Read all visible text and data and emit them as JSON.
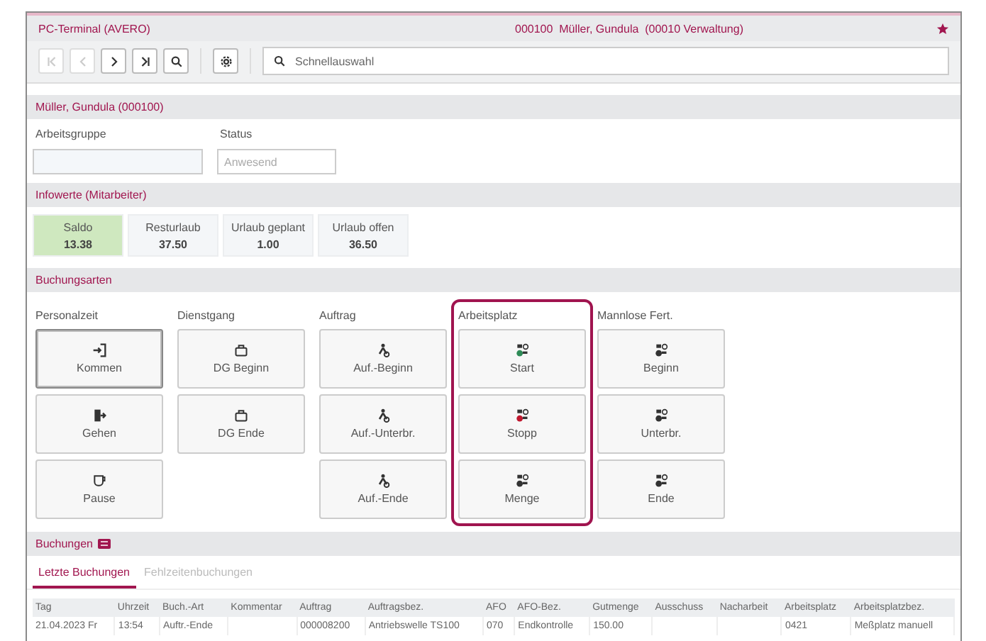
{
  "window": {
    "title": "PC-Terminal (AVERO)",
    "employee": "000100  Müller, Gundula  (00010 Verwaltung)"
  },
  "toolbar": {
    "nav_buttons": [
      {
        "kind": "first",
        "disabled": true
      },
      {
        "kind": "prev",
        "disabled": true
      },
      {
        "kind": "next",
        "disabled": false
      },
      {
        "kind": "last",
        "disabled": false
      }
    ],
    "search": {
      "placeholder": "Schnellauswahl"
    }
  },
  "employee_section": {
    "title": "Müller, Gundula (000100)",
    "fields": [
      {
        "label": "Arbeitsgruppe",
        "disabled": false
      },
      {
        "label": "Status",
        "placeholder": "Anwesend",
        "disabled": true
      }
    ]
  },
  "info_section": {
    "title": "Infowerte (Mitarbeiter)",
    "tiles": [
      {
        "label": "Saldo",
        "value": "13.38",
        "highlighted": true
      },
      {
        "label": "Resturlaub",
        "value": "37.50",
        "highlighted": false
      },
      {
        "label": "Urlaub geplant",
        "value": "1.00",
        "highlighted": false
      },
      {
        "label": "Urlaub offen",
        "value": "36.50",
        "highlighted": false
      }
    ]
  },
  "booking_types": {
    "title": "Buchungsarten",
    "groups": [
      {
        "label": "Personalzeit",
        "selected": false,
        "buttons": [
          {
            "label": "Kommen",
            "kind": "enter",
            "focused": true
          },
          {
            "label": "Gehen",
            "kind": "exit",
            "focused": false
          },
          {
            "label": "Pause",
            "kind": "cup",
            "focused": false
          }
        ]
      },
      {
        "label": "Dienstgang",
        "selected": false,
        "buttons": [
          {
            "label": "DG Beginn",
            "kind": "bag",
            "focused": false
          },
          {
            "label": "DG Ende",
            "kind": "bag",
            "focused": false
          }
        ]
      },
      {
        "label": "Auftrag",
        "selected": false,
        "buttons": [
          {
            "label": "Auf.-Beginn",
            "kind": "worker",
            "focused": false
          },
          {
            "label": "Auf.-Unterbr.",
            "kind": "worker",
            "focused": false
          },
          {
            "label": "Auf.-Ende",
            "kind": "worker",
            "focused": false
          }
        ]
      },
      {
        "label": "Arbeitsplatz",
        "selected": true,
        "buttons": [
          {
            "label": "Start",
            "kind": "machine",
            "color": "#2e8b57",
            "focused": false
          },
          {
            "label": "Stopp",
            "kind": "machine",
            "color": "#c0182f",
            "focused": false
          },
          {
            "label": "Menge",
            "kind": "machine",
            "focused": false
          }
        ]
      },
      {
        "label": "Mannlose Fert.",
        "selected": false,
        "buttons": [
          {
            "label": "Beginn",
            "kind": "machine",
            "focused": false
          },
          {
            "label": "Unterbr.",
            "kind": "machine",
            "focused": false
          },
          {
            "label": "Ende",
            "kind": "machine",
            "focused": false
          }
        ]
      }
    ]
  },
  "bookings": {
    "title": "Buchungen",
    "tabs": [
      {
        "label": "Letzte Buchungen",
        "selected": true
      },
      {
        "label": "Fehlzeitenbuchungen",
        "selected": false
      }
    ],
    "table": {
      "columns": [
        "Tag",
        "Uhrzeit",
        "Buch.-Art",
        "Kommentar",
        "Auftrag",
        "Auftragsbez.",
        "AFO",
        "AFO-Bez.",
        "Gutmenge",
        "Ausschuss",
        "Nacharbeit",
        "Arbeitsplatz",
        "Arbeitsplatzbez."
      ],
      "rows": [
        {
          "cells": [
            "21.04.2023 Fr",
            "13:54",
            "Auftr.-Ende",
            null,
            "000008200",
            "Antriebswelle TS100",
            "070",
            "Endkontrolle",
            "150.00",
            null,
            null,
            "0421",
            "Meßplatz manuell"
          ]
        }
      ]
    }
  }
}
